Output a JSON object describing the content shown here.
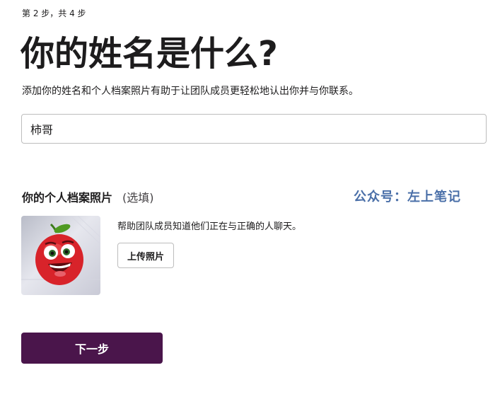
{
  "step": "第 2 步，共 4 步",
  "title": "你的姓名是什么?",
  "subtitle": "添加你的姓名和个人档案照片有助于让团队成员更轻松地认出你并与你联系。",
  "name_field": {
    "value": "柿哥",
    "placeholder": ""
  },
  "profile_photo": {
    "label": "你的个人档案照片",
    "optional": "(选填)",
    "help_text": "帮助团队成员知道他们正在与正确的人聊天。",
    "upload_label": "上传照片"
  },
  "watermark": "公众号：左上笔记",
  "next_label": "下一步",
  "colors": {
    "primary_button": "#4a154b",
    "watermark": "#4a6fa8",
    "text": "#1d1c1d",
    "border": "#bdbdbd"
  }
}
